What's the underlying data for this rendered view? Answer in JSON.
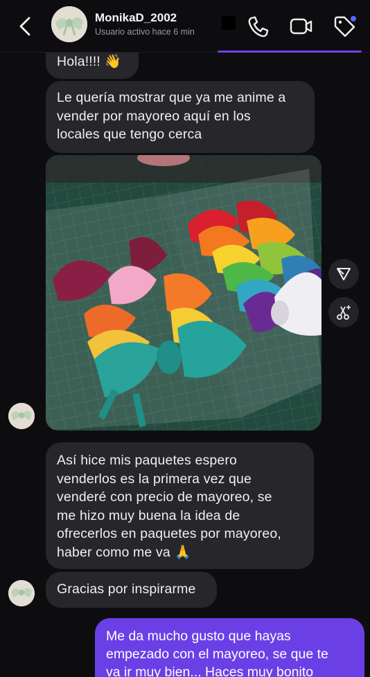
{
  "header": {
    "back_icon": "chevron-left-icon",
    "avatar_icon": "bow-avatar",
    "name": "MonikaD_2002",
    "status": "Usuario activo hace 6 min",
    "call_icon": "phone-icon",
    "video_icon": "video-camera-icon",
    "tag_icon": "tag-icon",
    "accent": "#7a3cf0",
    "notification_dot": "#4d6bff"
  },
  "messages": [
    {
      "type": "text",
      "lines": [
        "Hola!!!! 👋"
      ]
    },
    {
      "type": "text",
      "lines": [
        "Le quería mostrar que ya me anime a",
        "vender por mayoreo aquí en los",
        "locales que tengo cerca"
      ]
    },
    {
      "type": "image",
      "icon": "bow-packages-photo"
    },
    {
      "type": "text",
      "lines": [
        "Así hice mis paquetes espero",
        "venderlos es la primera vez que",
        "venderé con precio de mayoreo, se",
        "me hizo muy buena la idea de",
        "ofrecerlos en paquetes por mayoreo,",
        "haber como me va 🙏"
      ]
    },
    {
      "type": "text",
      "lines": [
        "Gracias por inspirarme"
      ]
    }
  ],
  "outgoing": {
    "lines": [
      "Me da mucho gusto que hayas",
      "empezado con el mayoreo, se que te",
      "va ir muy bien... Haces muy bonito"
    ],
    "color": "#6a40e6"
  },
  "side_actions": {
    "share_icon": "share-triangle-icon",
    "edit_icon": "scissors-sparkle-icon"
  }
}
